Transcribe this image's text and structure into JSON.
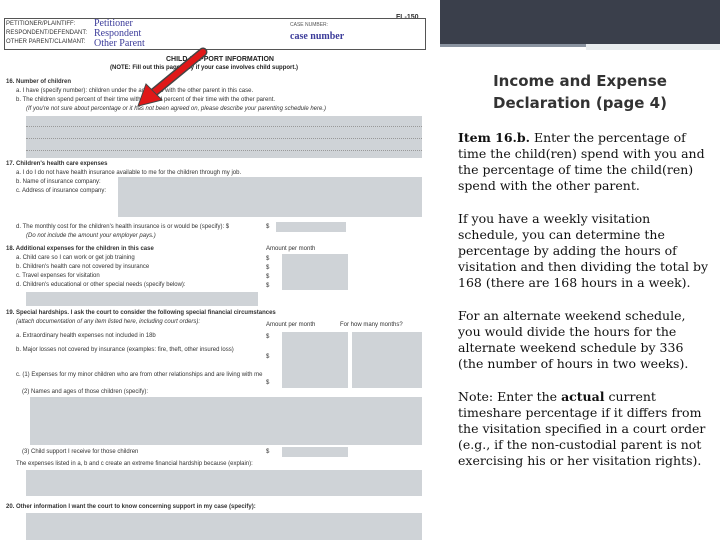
{
  "slide": {
    "title_line1": "Income and Expense",
    "title_line2": "Declaration (page 4)",
    "item_label": "Item 16.b.",
    "item_text": "Enter the percentage of time the child(ren) spend with you and the percentage of time the child(ren) spend with the other parent.",
    "weekly_text": "If you have a weekly visitation schedule, you can determine the percentage by adding the hours of visitation and then dividing the total by 168 (there are 168 hours in a week).",
    "alternate_text": "For an alternate weekend schedule, you would divide the hours for the alternate weekend schedule by 336 (the number of hours in two weeks).",
    "note_prefix": "Note:  Enter the ",
    "note_bold": "actual",
    "note_suffix": " current timeshare percentage if it differs from the visitation specified in a court order (e.g., if the non-custodial parent is not exercising his or her visitation rights)."
  },
  "form": {
    "form_number": "FL-150",
    "header_labels": [
      "PETITIONER/PLAINTIFF:",
      "RESPONDENT/DEFENDANT:",
      "OTHER PARENT/CLAIMANT:"
    ],
    "header_values": [
      "Petitioner",
      "Respondent",
      "Other Parent"
    ],
    "case_label": "CASE NUMBER:",
    "case_value": "case number",
    "section_title": "CHILD SUPPORT INFORMATION",
    "section_note": "(NOTE: Fill out this page only if your case involves child support.)",
    "lines": [
      "16.  Number of children",
      "a. I have (specify number):          children under the age of 18 with the other parent in this case.",
      "b. The children spend          percent of their time with me and          percent of their time with the other parent.",
      "(If you're not sure about percentage or it has not been agreed on, please describe your parenting schedule here.)",
      "17.  Children's health care expenses",
      "a.     I do      I do not     have health insurance available to me for the children through my job.",
      "b. Name of insurance company:",
      "c. Address of insurance company:",
      "d. The monthly cost for the children's health insurance is or would be (specify):   $",
      "(Do not include the amount your employer pays.)",
      "18.  Additional expenses for the children in this case",
      "a. Child care so I can work or get job training",
      "b. Children's health care not covered by insurance",
      "c. Travel expenses for visitation",
      "d. Children's educational or other special needs (specify below):",
      "19.  Special hardships. I ask the court to consider the following special financial circumstances",
      "(attach documentation of any item listed here, including court orders):",
      "a. Extraordinary health expenses not included in 18b",
      "b. Major losses not covered by insurance (examples: fire, theft, other insured loss)",
      "c. (1) Expenses for my minor children who are from other relationships and are living with me",
      "(2) Names and ages of those children (specify):",
      "(3) Child support I receive for those children",
      "The expenses listed in a, b and c create an extreme financial hardship because (explain):",
      "20.  Other information I want the court to know concerning support in my case (specify):"
    ],
    "amount_header": "Amount per month",
    "how_many_months": "For how many months?",
    "dollar": "$"
  }
}
